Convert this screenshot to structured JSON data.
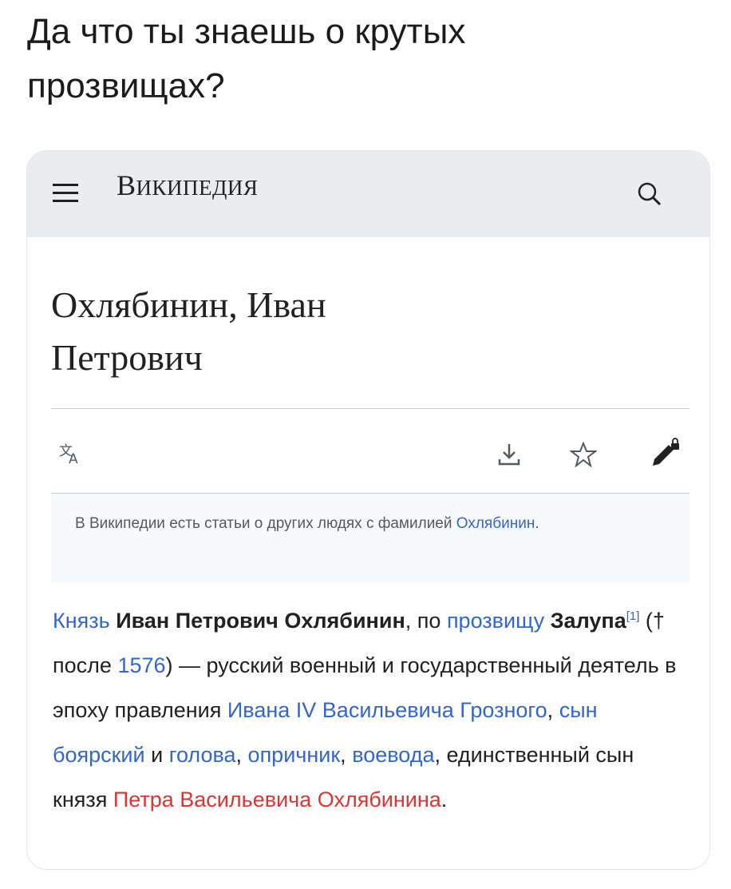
{
  "caption": {
    "line1": "Да что ты знаешь о крутых",
    "line2": "прозвищах?"
  },
  "wiki_header": {
    "menu_icon": "hamburger-menu-icon",
    "logo_first": "В",
    "logo_rest": "ИКИПЕДИЯ",
    "search_icon": "search-icon",
    "background": "#eaecf0"
  },
  "article": {
    "title_line1": "Охлябинин, Иван",
    "title_line2": "Петрович",
    "toolbar": {
      "language_icon": "language-icon",
      "download_icon": "download-icon",
      "watch_icon": "star-icon",
      "edit_icon": "edit-lock-icon"
    },
    "hatnote": {
      "text": "В Википедии есть статьи о других людях с фамилией",
      "link": "Охлябинин",
      "end": "."
    },
    "body": {
      "t1": "Князь",
      "t2": "Иван Петрович Охлябинин",
      "t3": ", по",
      "t4": "прозвищу",
      "t5": "Залупа",
      "t6": "[1]",
      "t7": " (†  после",
      "t8": "1576",
      "t9": ") — русский военный и государственный деятель в эпоху правления",
      "t10": "Ивана IV Васильевича Грозного",
      "t11": ",",
      "t12": "сын боярский",
      "t13": " и",
      "t14": "голова",
      "t15": ",",
      "t16": "опричник",
      "t17": ",",
      "t18": "воевода",
      "t19": ", единственный сын князя",
      "t20": "Петра Васильевича Охлябинина",
      "t21": "."
    },
    "colors": {
      "link": "#3366cc",
      "redlink": "#dd3333",
      "text": "#202122"
    }
  }
}
